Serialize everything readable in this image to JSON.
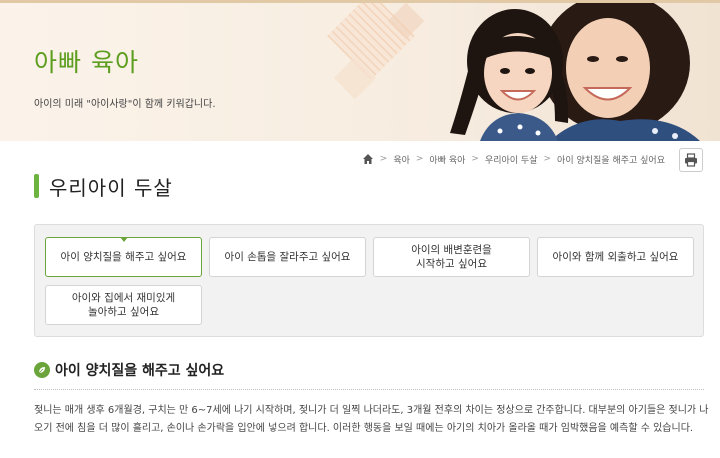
{
  "banner": {
    "title": "아빠 육아",
    "subtitle": "아이의 미래 \"아이사랑\"이 함께 키워갑니다."
  },
  "breadcrumb": {
    "items": [
      "육아",
      "아빠 육아",
      "우리아이 두살",
      "아이 양치질을 해주고 싶어요"
    ],
    "separator": ">"
  },
  "page": {
    "title": "우리아이 두살"
  },
  "tabs": [
    {
      "label": "아이 양치질을 해주고 싶어요",
      "active": true
    },
    {
      "label": "아이 손톱을 잘라주고 싶어요",
      "active": false
    },
    {
      "label": "아이의 배변훈련을\n시작하고 싶어요",
      "active": false
    },
    {
      "label": "아이와 함께 외출하고 싶어요",
      "active": false
    },
    {
      "label": "아이와 집에서 재미있게\n놀아하고 싶어요",
      "active": false
    }
  ],
  "section": {
    "title": "아이 양치질을 해주고 싶어요",
    "body": "젖니는 매개 생후 6개월경, 구치는 만 6~7세에 나기 시작하며, 젖니가 더 일찍 나더라도, 3개월 전후의 차이는 정상으로 간주합니다. 대부분의 아기들은 젖니가 나오기 전에 침을 더 많이 흘리고, 손이나 손가락을 입안에 넣으려 합니다. 이러한 행동을 보일 때에는 아기의 치아가 올라올 때가 임박했음을 예측할 수 있습니다."
  },
  "colors": {
    "accent": "#6aa43a",
    "title_green": "#5d9e1f",
    "banner_bg": "#f8eee2"
  },
  "icons": [
    "home-icon",
    "print-icon",
    "leaf-icon"
  ]
}
